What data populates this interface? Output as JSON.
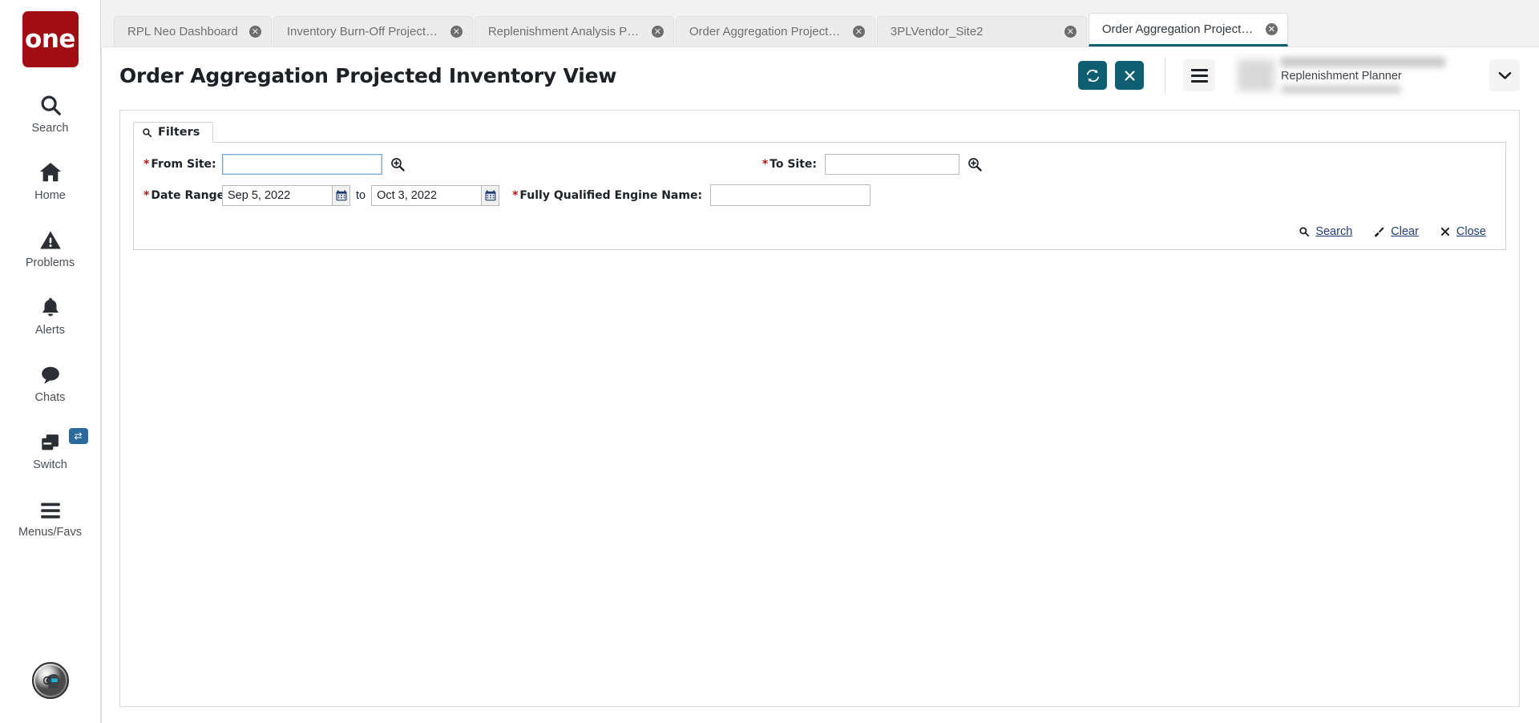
{
  "sidebar": {
    "logo_text": "one",
    "items": [
      {
        "label": "Search",
        "icon": "search-icon"
      },
      {
        "label": "Home",
        "icon": "home-icon"
      },
      {
        "label": "Problems",
        "icon": "warning-triangle-icon"
      },
      {
        "label": "Alerts",
        "icon": "bell-icon"
      },
      {
        "label": "Chats",
        "icon": "chat-bubble-icon"
      },
      {
        "label": "Switch",
        "icon": "switch-windows-icon",
        "badge_icon": "exchange-arrows-icon"
      },
      {
        "label": "Menus/Favs",
        "icon": "hamburger-icon"
      }
    ],
    "assistant_icon": "ai-assistant-avatar"
  },
  "tabs": [
    {
      "label": "RPL Neo Dashboard",
      "active": false
    },
    {
      "label": "Inventory Burn-Off Projected Inv...",
      "active": false
    },
    {
      "label": "Replenishment Analysis Projecte...",
      "active": false
    },
    {
      "label": "Order Aggregation Projected Inv...",
      "active": false
    },
    {
      "label": "3PLVendor_Site2",
      "active": false
    },
    {
      "label": "Order Aggregation Projected Inv...",
      "active": true
    }
  ],
  "header": {
    "title": "Order Aggregation Projected Inventory View",
    "refresh_icon": "refresh-icon",
    "close_icon": "close-icon",
    "menu_icon": "hamburger-icon",
    "user_role": "Replenishment Planner",
    "chevron_icon": "chevron-down-icon",
    "accent_color": "#0d5e70"
  },
  "filters": {
    "tab_label": "Filters",
    "tab_icon": "search-icon",
    "fields": {
      "from_site": {
        "label": "From Site:",
        "required": true,
        "value": "",
        "placeholder": "",
        "picker_icon": "zoom-in-picker-icon",
        "focused": true
      },
      "to_site": {
        "label": "To Site:",
        "required": true,
        "value": "",
        "placeholder": "",
        "picker_icon": "zoom-in-picker-icon",
        "focused": false
      },
      "date_range": {
        "label": "Date Range:",
        "required": true,
        "from_value": "Sep 5, 2022",
        "to_word": "to",
        "to_value": "Oct 3, 2022",
        "calendar_icon": "calendar-icon"
      },
      "engine_name": {
        "label": "Fully Qualified Engine Name:",
        "required": true,
        "value": "",
        "placeholder": ""
      }
    },
    "actions": [
      {
        "label": "Search",
        "icon": "search-icon"
      },
      {
        "label": "Clear",
        "icon": "clear-brush-icon"
      },
      {
        "label": "Close",
        "icon": "close-x-icon"
      }
    ]
  }
}
